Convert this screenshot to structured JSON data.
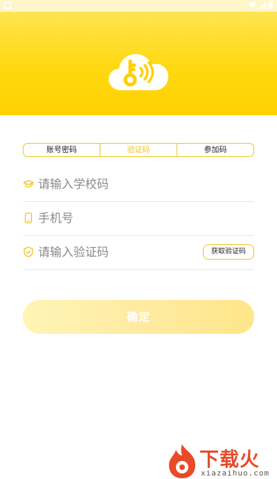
{
  "tabs": [
    {
      "label": "账号密码"
    },
    {
      "label": "验证码"
    },
    {
      "label": "参加码"
    }
  ],
  "active_tab": 1,
  "form": {
    "school": {
      "placeholder": "请输入学校码",
      "value": ""
    },
    "phone": {
      "placeholder": "手机号",
      "value": ""
    },
    "code": {
      "placeholder": "请输入验证码",
      "value": ""
    },
    "get_code_label": "获取验证码"
  },
  "submit_label": "确定",
  "icons": {
    "logo": "cloud-key-signal-icon",
    "school": "graduation-cap-icon",
    "phone": "mobile-phone-icon",
    "code": "shield-check-icon"
  },
  "colors": {
    "accent": "#f0c419",
    "header_top": "#ffe451",
    "header_bottom": "#ffd100",
    "button_gradient_start": "#fff4b6",
    "button_gradient_end": "#ffe68a"
  },
  "watermark": {
    "title": "下载火",
    "subtitle": "xiazaihuo.com"
  }
}
